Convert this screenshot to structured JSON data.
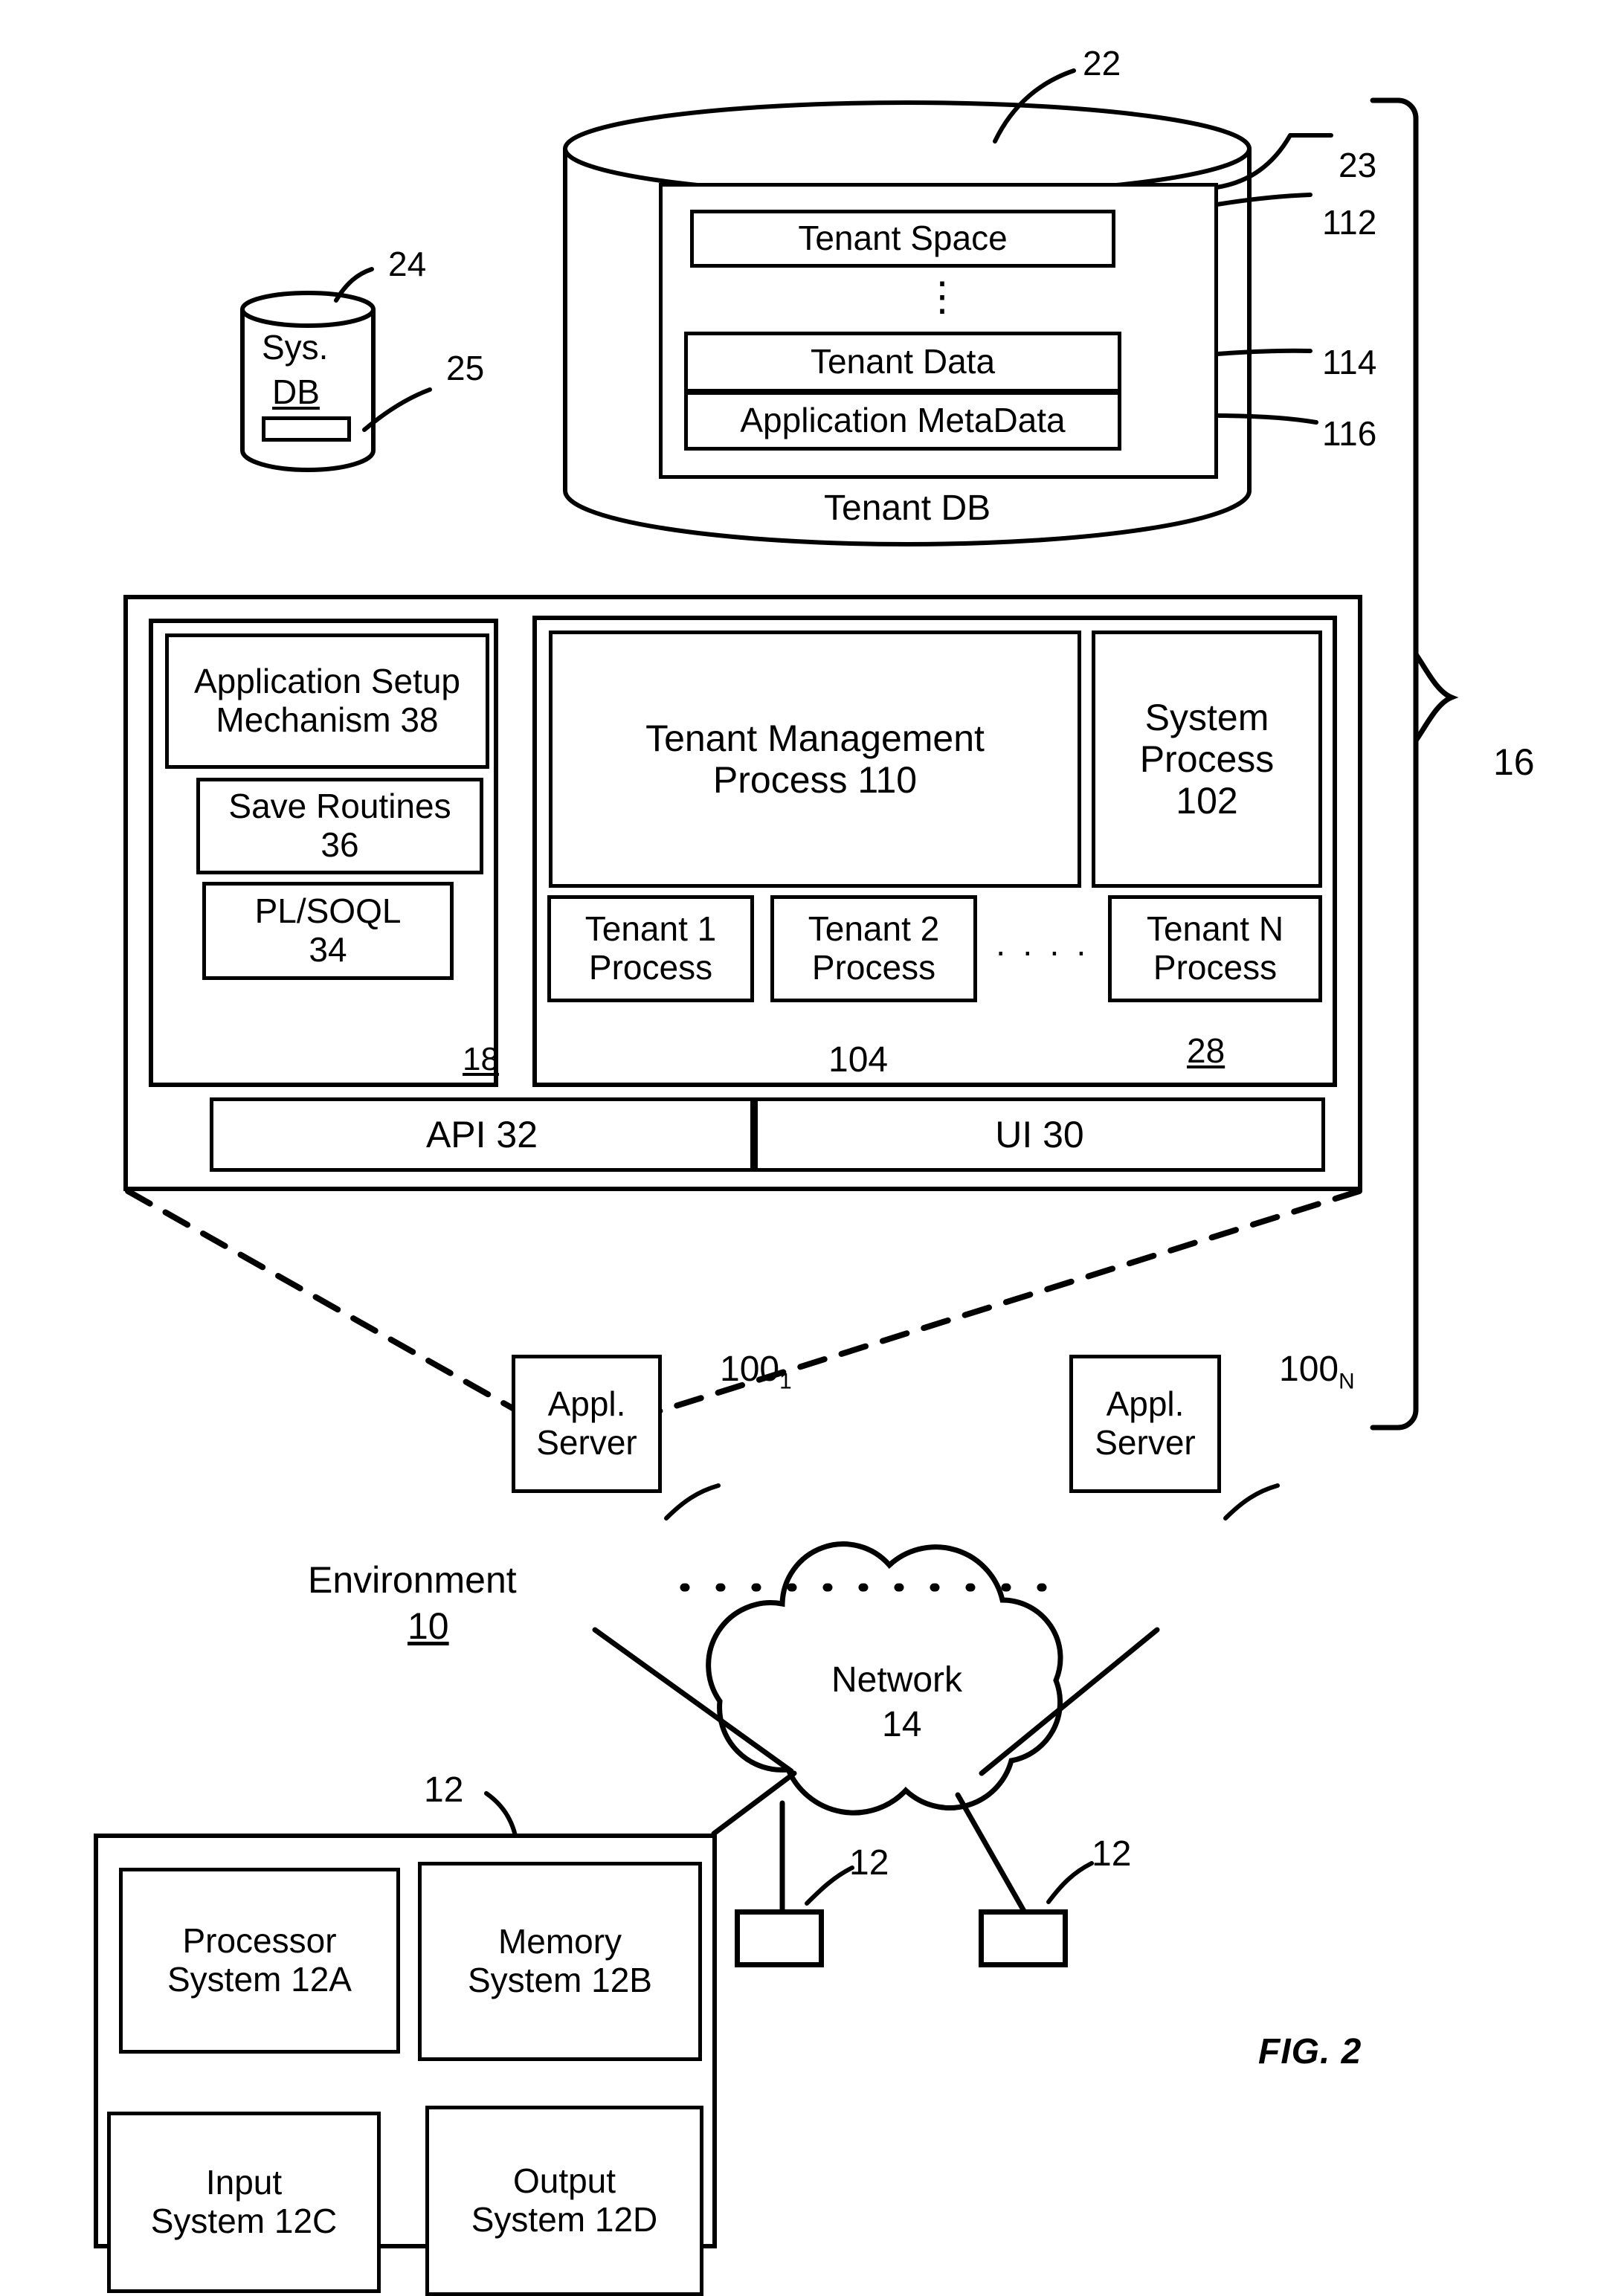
{
  "figure": {
    "caption": "FIG. 2",
    "environment_label": "Environment",
    "environment_ref": "10",
    "bracket_ref": "16"
  },
  "tenant_db": {
    "title": "Tenant DB",
    "ref": "22",
    "inner_ref": "23",
    "ellipsis": "⋮",
    "rows": [
      {
        "label": "Tenant Space",
        "ref": "112"
      },
      {
        "label": "Tenant Data",
        "ref": "114"
      },
      {
        "label": "Application MetaData",
        "ref": "116"
      }
    ]
  },
  "sys_db": {
    "line1": "Sys.",
    "line2": "DB",
    "ref": "24",
    "slot_ref": "25"
  },
  "server": {
    "ref": "18",
    "process_space_ref": "28",
    "left_column": [
      {
        "label": "Application Setup Mechanism 38",
        "name": "application-setup-mechanism"
      },
      {
        "label": "Save Routines 36",
        "name": "save-routines"
      },
      {
        "label": "PL/SOQL 34",
        "name": "pl-soql"
      }
    ],
    "tenant_management_process": "Tenant Management Process 110",
    "system_process": "System Process 102",
    "tenant_processes": [
      {
        "label": "Tenant 1 Process"
      },
      {
        "label": "Tenant 2 Process"
      },
      {
        "label": "Tenant N Process"
      }
    ],
    "tenant_process_dots": "· · · ·",
    "tenant_process_ref": "104",
    "api": "API 32",
    "ui": "UI 30"
  },
  "app_servers": [
    {
      "line1": "Appl.",
      "line2": "Server",
      "ref_base": "100",
      "ref_sub": "1"
    },
    {
      "line1": "Appl.",
      "line2": "Server",
      "ref_base": "100",
      "ref_sub": "N"
    }
  ],
  "network": {
    "line1": "Network",
    "line2": "14"
  },
  "user_system": {
    "ref": "12",
    "blocks": [
      {
        "line1": "Processor",
        "line2": "System 12A"
      },
      {
        "line1": "Memory",
        "line2": "System 12B"
      },
      {
        "line1": "Input",
        "line2": "System 12C"
      },
      {
        "line1": "Output",
        "line2": "System 12D"
      }
    ]
  },
  "client_nodes": [
    {
      "ref": "12"
    },
    {
      "ref": "12"
    }
  ]
}
